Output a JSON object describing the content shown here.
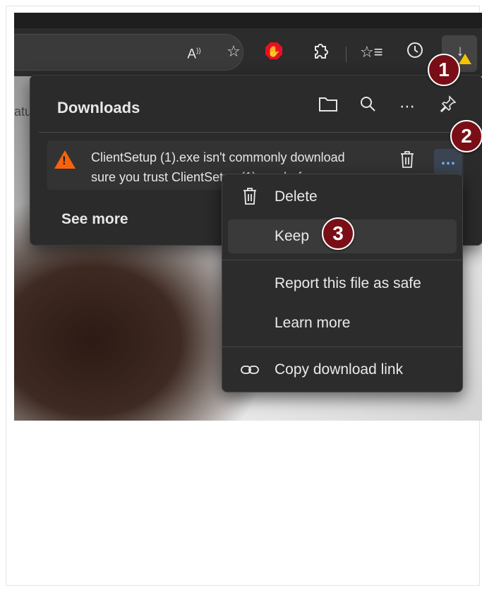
{
  "toolbar": {
    "icons": [
      "read-aloud-icon",
      "favorite-star-icon",
      "ad-block-hand-icon",
      "extensions-icon",
      "favorites-list-icon",
      "history-icon",
      "download-arrow-icon"
    ]
  },
  "page": {
    "partial_text": "atu"
  },
  "downloads_panel": {
    "title": "Downloads",
    "header_icons": [
      "folder-icon",
      "search-icon",
      "more-icon",
      "pin-icon"
    ],
    "item": {
      "line1": "ClientSetup (1).exe isn't commonly download",
      "line2": "sure you trust ClientSetup (1).exe before"
    },
    "see_more": "See more"
  },
  "context_menu": {
    "items": [
      {
        "label": "Delete",
        "icon": "trash-icon"
      },
      {
        "label": "Keep",
        "icon": ""
      },
      {
        "label": "Report this file as safe",
        "icon": ""
      },
      {
        "label": "Learn more",
        "icon": ""
      },
      {
        "label": "Copy download link",
        "icon": "link-icon"
      }
    ]
  },
  "callouts": [
    "1",
    "2",
    "3"
  ],
  "colors": {
    "callout_bg": "#7a0e16",
    "warning": "#f7630c",
    "accent_blue": "#7fb2ff",
    "ad_block_red": "#e81123"
  }
}
